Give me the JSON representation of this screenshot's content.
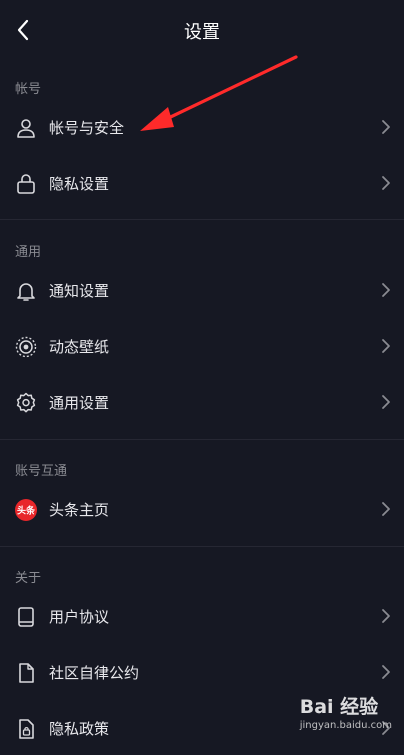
{
  "header": {
    "title": "设置",
    "back_icon": "chevron-left-icon"
  },
  "sections": {
    "account": {
      "label": "帐号",
      "items": [
        {
          "label": "帐号与安全",
          "icon": "user-icon"
        },
        {
          "label": "隐私设置",
          "icon": "lock-icon"
        }
      ]
    },
    "general": {
      "label": "通用",
      "items": [
        {
          "label": "通知设置",
          "icon": "bell-icon"
        },
        {
          "label": "动态壁纸",
          "icon": "live-wallpaper-icon"
        },
        {
          "label": "通用设置",
          "icon": "gear-icon"
        }
      ]
    },
    "linked": {
      "label": "账号互通",
      "items": [
        {
          "label": "头条主页",
          "icon": "toutiao-logo-icon",
          "logo_text": "头条"
        }
      ]
    },
    "about": {
      "label": "关于",
      "items": [
        {
          "label": "用户协议",
          "icon": "book-icon"
        },
        {
          "label": "社区自律公约",
          "icon": "document-icon"
        },
        {
          "label": "隐私政策",
          "icon": "privacy-doc-icon"
        }
      ]
    }
  },
  "annotation": {
    "arrow_color": "#ff2a2a"
  },
  "watermark": {
    "brand": "Bai 经验",
    "url": "jingyan.baidu.com"
  },
  "colors": {
    "background": "#161823",
    "text": "#e8e8ec",
    "muted": "#8a8b92",
    "divider": "#262733",
    "toutiao_red": "#e8262a"
  }
}
